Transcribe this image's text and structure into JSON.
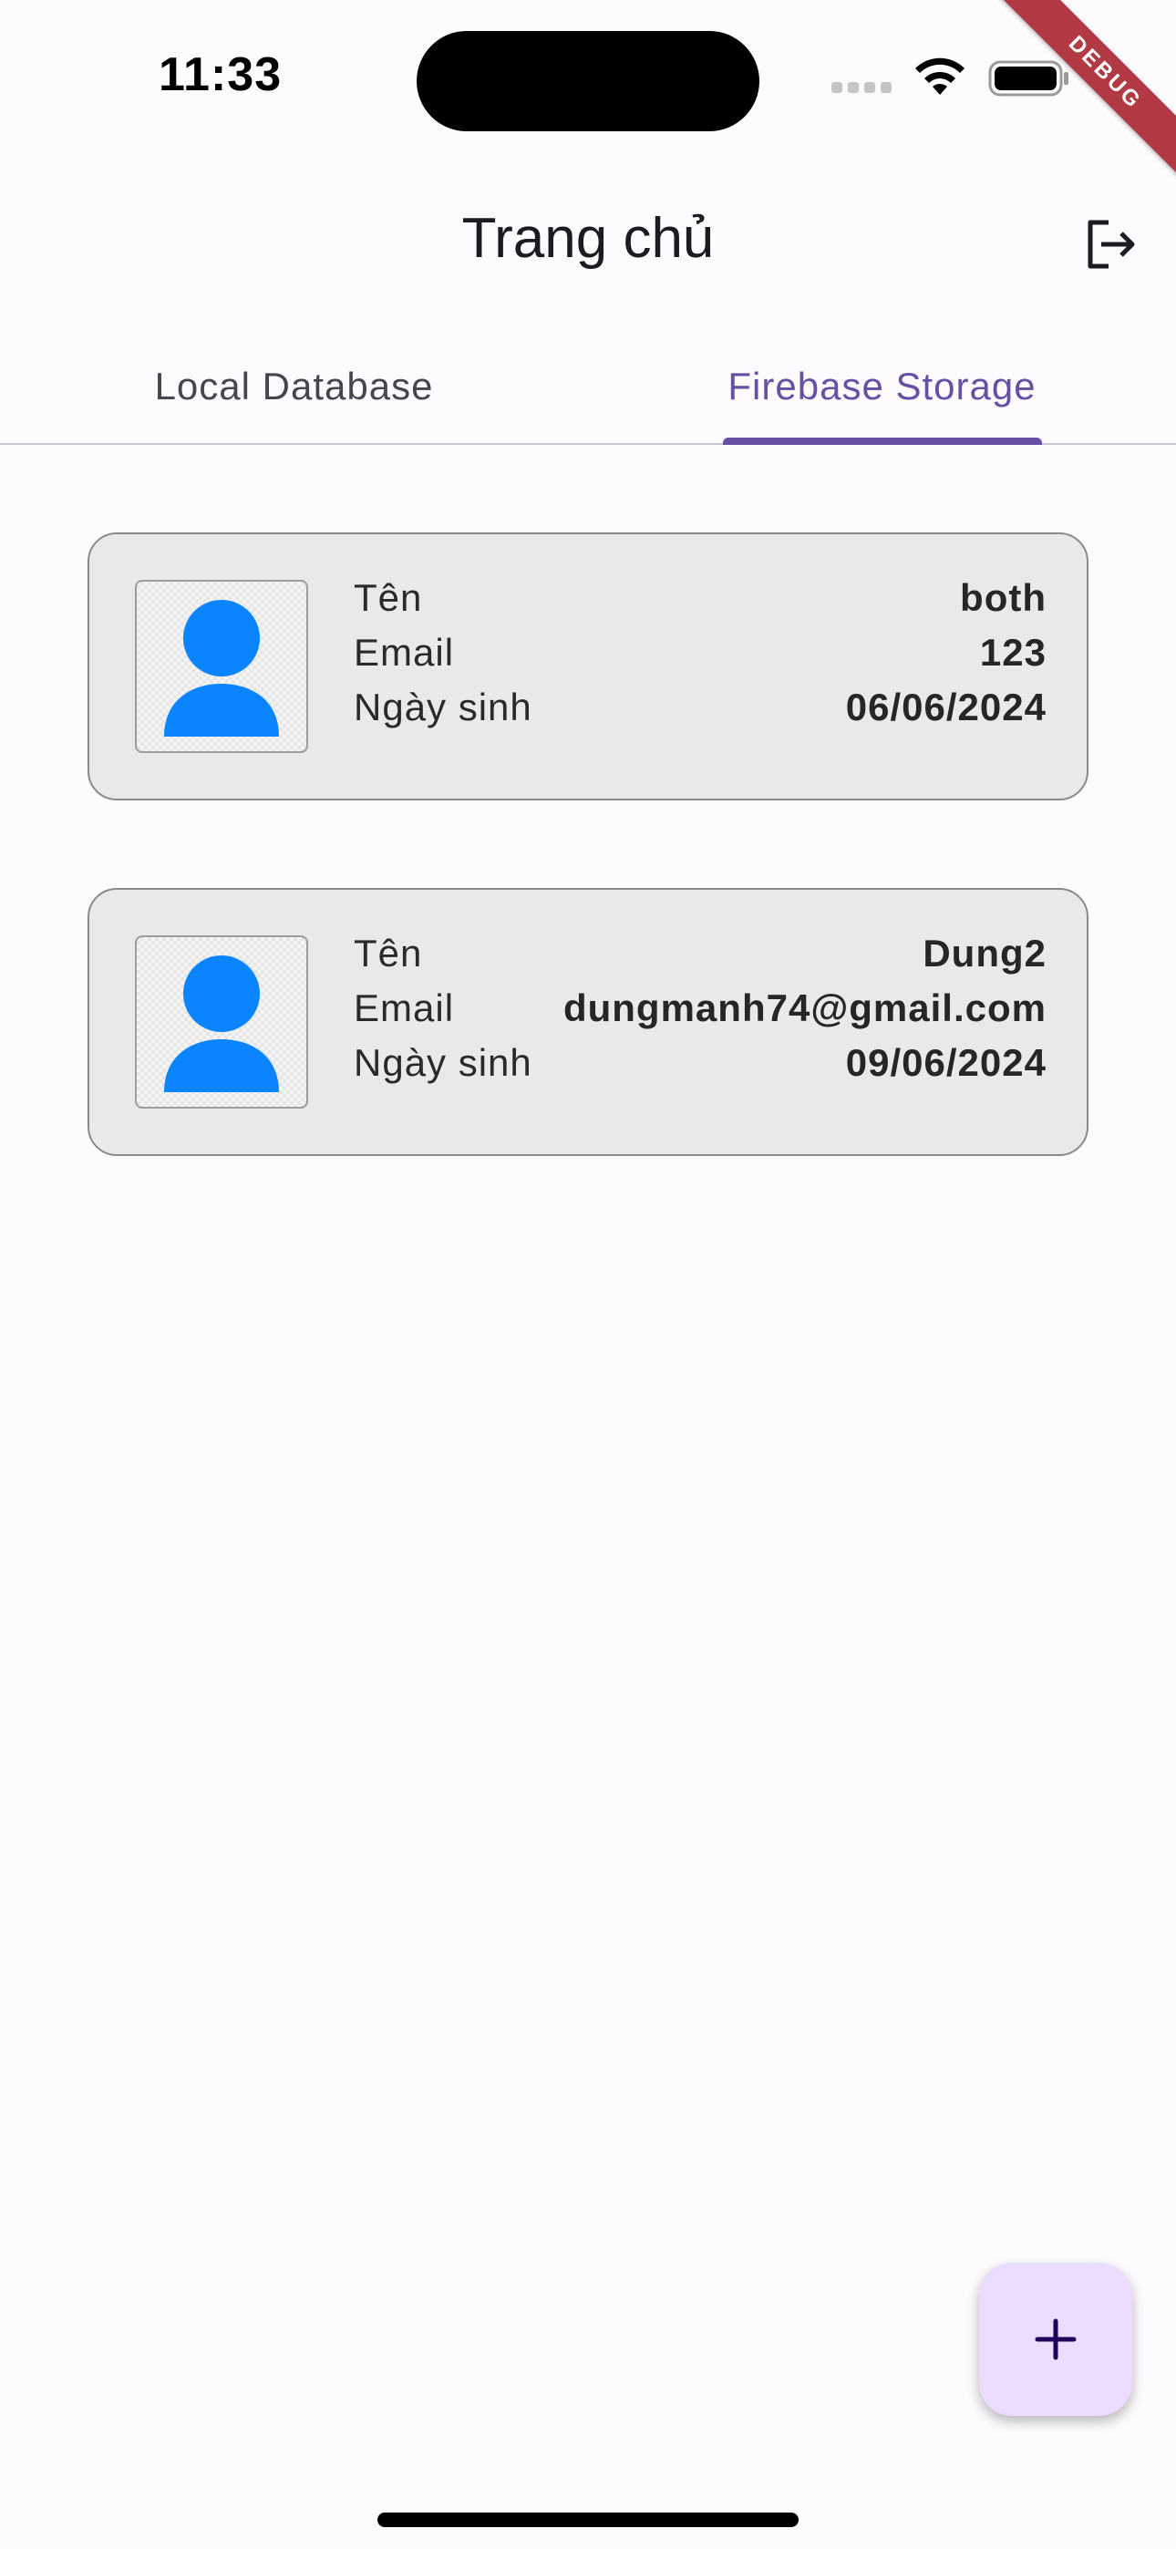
{
  "status_bar": {
    "time": "11:33",
    "icons": [
      "cellular-signal-icon",
      "wifi-icon",
      "battery-icon"
    ]
  },
  "debug_banner": "DEBUG",
  "app_bar": {
    "title": "Trang chủ",
    "action_icon": "logout-icon"
  },
  "tabs": [
    {
      "label": "Local Database",
      "selected": false
    },
    {
      "label": "Firebase Storage",
      "selected": true
    }
  ],
  "users": [
    {
      "avatar_icon": "person-avatar-icon",
      "fields": [
        {
          "label": "Tên",
          "value": "both"
        },
        {
          "label": "Email",
          "value": "123"
        },
        {
          "label": "Ngày sinh",
          "value": "06/06/2024"
        }
      ]
    },
    {
      "avatar_icon": "person-avatar-icon",
      "fields": [
        {
          "label": "Tên",
          "value": "Dung2"
        },
        {
          "label": "Email",
          "value": "dungmanh74@gmail.com"
        },
        {
          "label": "Ngày sinh",
          "value": "09/06/2024"
        }
      ]
    }
  ],
  "fab": {
    "icon": "plus-icon"
  },
  "colors": {
    "primary": "#6750a4",
    "fab_background": "#eaddff",
    "card_background": "#e9e9e9",
    "avatar_blue": "#0a84ff",
    "debug_ribbon": "#b13a44"
  }
}
